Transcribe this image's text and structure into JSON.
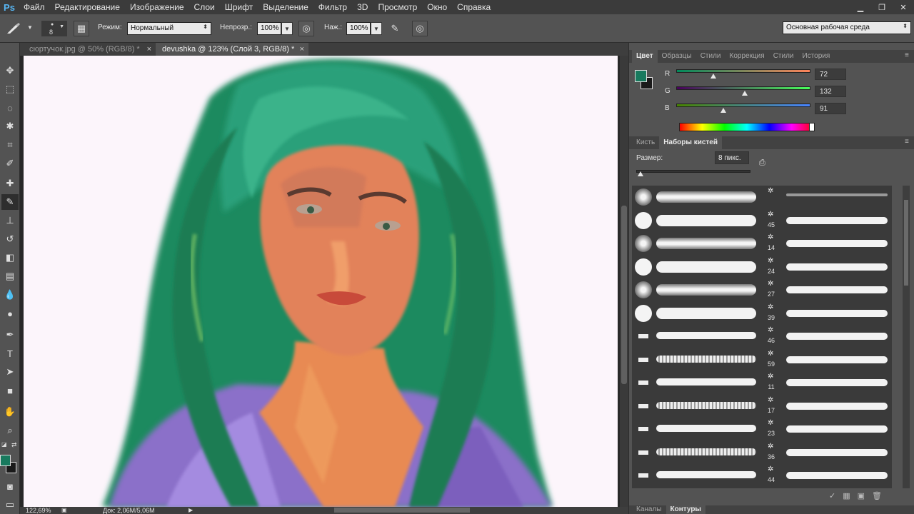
{
  "app": {
    "logo": "Ps"
  },
  "menu": [
    "Файл",
    "Редактирование",
    "Изображение",
    "Слои",
    "Шрифт",
    "Выделение",
    "Фильтр",
    "3D",
    "Просмотр",
    "Окно",
    "Справка"
  ],
  "options": {
    "brush_size": "8",
    "mode_label": "Режим:",
    "mode_value": "Нормальный",
    "opacity_label": "Непрозр.:",
    "opacity_value": "100%",
    "pressure_label": "Наж.:",
    "pressure_value": "100%",
    "workspace": "Основная рабочая среда"
  },
  "documents": {
    "tabs": [
      {
        "label": "сюртучок.jpg @ 50% (RGB/8) *",
        "active": false
      },
      {
        "label": "devushka @ 123% (Слой 3, RGB/8) *",
        "active": true
      }
    ]
  },
  "status": {
    "zoom": "122,69%",
    "doc": "Док: 2,06M/5,06M"
  },
  "color_panel": {
    "tabs": [
      "Цвет",
      "Образцы",
      "Стили",
      "Коррекция",
      "Стили",
      "История"
    ],
    "r_label": "R",
    "r_value": "72",
    "g_label": "G",
    "g_value": "132",
    "b_label": "B",
    "b_value": "91",
    "foreground": "#187a5e"
  },
  "brush_panel": {
    "tabs": [
      "Кисть",
      "Наборы кистей"
    ],
    "size_label": "Размер:",
    "size_value": "8 пикс.",
    "right_numbers": [
      "",
      "45",
      "14",
      "24",
      "27",
      "39",
      "46",
      "59",
      "11",
      "17",
      "23",
      "36",
      "44"
    ]
  },
  "bottom_panel": {
    "tabs": [
      "Каналы",
      "Контуры"
    ]
  }
}
